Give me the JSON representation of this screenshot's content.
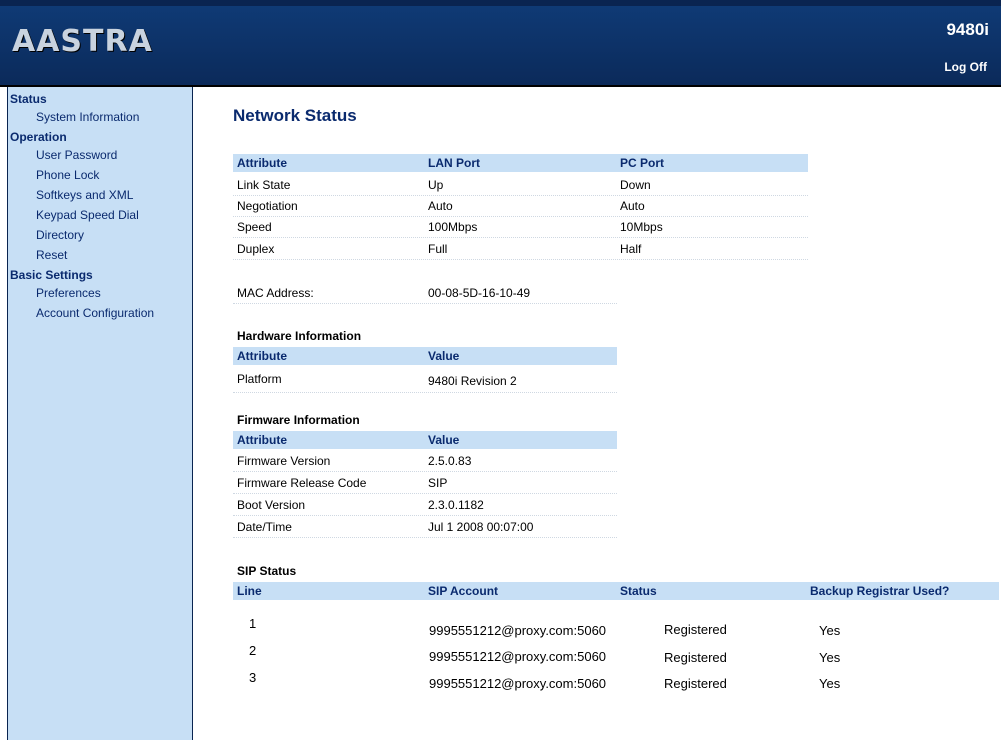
{
  "header": {
    "logo_text": "AASTRA",
    "model": "9480i",
    "logoff_label": "Log Off"
  },
  "sidebar": {
    "groups": [
      {
        "label": "Status",
        "items": [
          "System Information"
        ]
      },
      {
        "label": "Operation",
        "items": [
          "User Password",
          "Phone Lock",
          "Softkeys and XML",
          "Keypad Speed Dial",
          "Directory",
          "Reset"
        ]
      },
      {
        "label": "Basic Settings",
        "items": [
          "Preferences",
          "Account Configuration"
        ]
      }
    ]
  },
  "main": {
    "title": "Network Status",
    "network": {
      "headers": [
        "Attribute",
        "LAN Port",
        "PC Port"
      ],
      "rows": [
        [
          "Link State",
          "Up",
          "Down"
        ],
        [
          "Negotiation",
          "Auto",
          "Auto"
        ],
        [
          "Speed",
          "100Mbps",
          "10Mbps"
        ],
        [
          "Duplex",
          "Full",
          "Half"
        ]
      ]
    },
    "mac": {
      "label": "MAC Address:",
      "value": "00-08-5D-16-10-49"
    },
    "hardware": {
      "title": "Hardware Information",
      "headers": [
        "Attribute",
        "Value"
      ],
      "rows": [
        [
          "Platform",
          "9480i Revision 2"
        ]
      ]
    },
    "firmware": {
      "title": "Firmware Information",
      "headers": [
        "Attribute",
        "Value"
      ],
      "rows": [
        [
          "Firmware Version",
          "2.5.0.83"
        ],
        [
          "Firmware Release Code",
          "SIP"
        ],
        [
          "Boot Version",
          "2.3.0.1182"
        ],
        [
          "Date/Time",
          "Jul 1 2008 00:07:00"
        ]
      ]
    },
    "sip": {
      "title": "SIP Status",
      "headers": [
        "Line",
        "SIP Account",
        "Status",
        "Backup Registrar Used?"
      ],
      "rows": [
        [
          "1",
          "9995551212@proxy.com:5060",
          "Registered",
          "Yes"
        ],
        [
          "2",
          "9995551212@proxy.com:5060",
          "Registered",
          "Yes"
        ],
        [
          "3",
          "9995551212@proxy.com:5060",
          "Registered",
          "Yes"
        ]
      ]
    }
  }
}
